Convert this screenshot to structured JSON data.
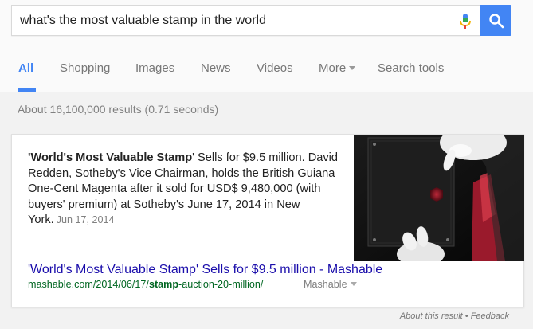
{
  "search": {
    "query": "what's the most valuable stamp in the world"
  },
  "tabs": [
    {
      "label": "All"
    },
    {
      "label": "Shopping"
    },
    {
      "label": "Images"
    },
    {
      "label": "News"
    },
    {
      "label": "Videos"
    },
    {
      "label": "More"
    },
    {
      "label": "Search tools"
    }
  ],
  "stats": "About 16,100,000 results (0.71 seconds)",
  "featured_snippet": {
    "text_bold_1": "'World's Most Valuable Stamp",
    "text_rest_1": "' Sells for $9.5 million. David Redden, Sotheby's Vice Chairman, holds the British Guiana One-Cent Magenta after it sold for USD$ 9,480,000 (with buyers' premium) at Sotheby's June 17, 2014 in New York.",
    "date": "Jun 17, 2014",
    "result_title": "'World's Most Valuable Stamp' Sells for $9.5 million - Mashable",
    "url_prefix": "mashable.com/2014/06/17/",
    "url_bold": "stamp",
    "url_suffix": "-auction-20-million/",
    "source": "Mashable"
  },
  "footer": {
    "about": "About this result",
    "separator": " • ",
    "feedback": "Feedback"
  },
  "colors": {
    "accent": "#4285f4",
    "link": "#1a0dab",
    "url": "#006621"
  }
}
